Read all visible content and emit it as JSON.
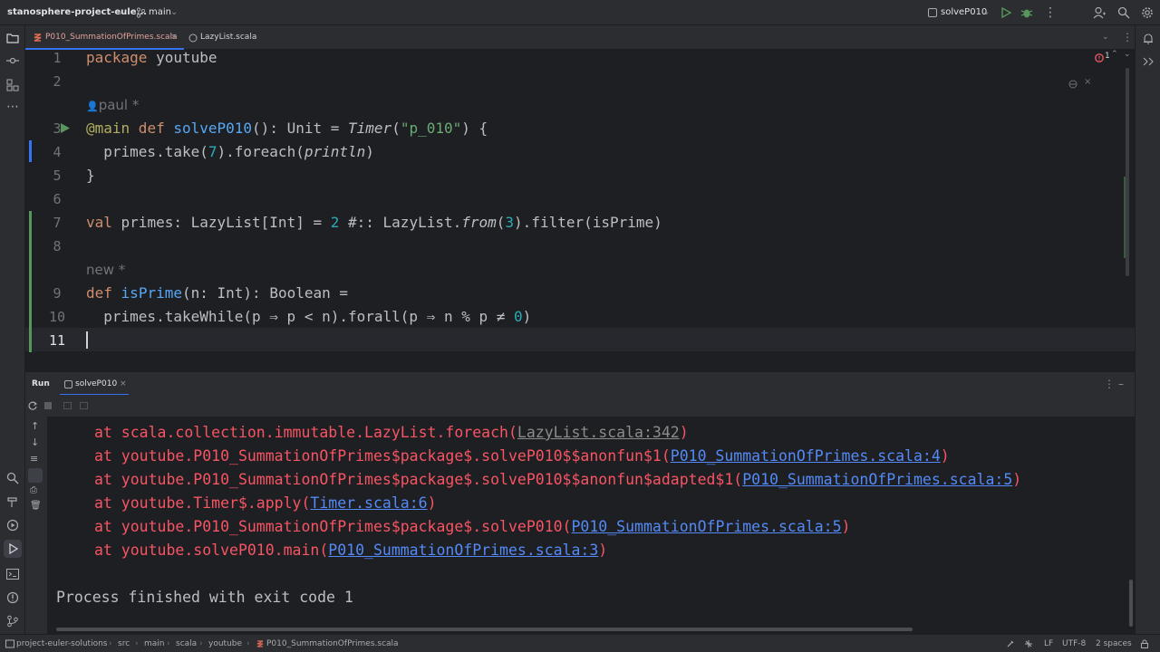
{
  "titlebar": {
    "project": "stanosphere-project-eule...",
    "branch": "main",
    "run_config": "solveP010"
  },
  "tabs": [
    {
      "label": "P010_SummationOfPrimes.scala",
      "active": true
    },
    {
      "label": "LazyList.scala",
      "active": false
    }
  ],
  "editor": {
    "problems_count": "1",
    "line_numbers": [
      "1",
      "2",
      "3",
      "4",
      "5",
      "6",
      "7",
      "8",
      "9",
      "10",
      "11"
    ],
    "author_hint": "paul *",
    "new_hint": "new *",
    "code": {
      "l1_kw": "package",
      "l1_name": " youtube",
      "l3_ann": "@main",
      "l3_def": " def ",
      "l3_fn": "solveP010",
      "l3_rest1": "(): Unit = ",
      "l3_timer": "Timer",
      "l3_paren": "(",
      "l3_str": "\"p_010\"",
      "l3_rest2": ") {",
      "l4_a": "  primes.take(",
      "l4_num": "7",
      "l4_b": ").foreach(",
      "l4_it": "println",
      "l4_c": ")",
      "l5": "}",
      "l7_kw": "val",
      "l7_a": " primes: LazyList[Int] = ",
      "l7_num1": "2",
      "l7_b": " #:: LazyList.",
      "l7_it": "from",
      "l7_c": "(",
      "l7_num2": "3",
      "l7_d": ").filter(isPrime)",
      "l9_kw": "def",
      "l9_sp": " ",
      "l9_fn": "isPrime",
      "l9_rest": "(n: Int): Boolean =",
      "l10_a": "  primes.takeWhile(p ⇒ p < n).forall(p ⇒ n % p ≠ ",
      "l10_num": "0",
      "l10_b": ")"
    }
  },
  "run_panel": {
    "title": "Run",
    "tab": "solveP010"
  },
  "console": {
    "lines": [
      {
        "pre": "at scala.collection.immutable.LazyList.foreach(",
        "link": "LazyList.scala:342",
        "post": ")",
        "gray": true
      },
      {
        "pre": "at youtube.P010_SummationOfPrimes$package$.solveP010$$anonfun$1(",
        "link": "P010_SummationOfPrimes.scala:4",
        "post": ")"
      },
      {
        "pre": "at youtube.P010_SummationOfPrimes$package$.solveP010$$anonfun$adapted$1(",
        "link": "P010_SummationOfPrimes.scala:5",
        "post": ")"
      },
      {
        "pre": "at youtube.Timer$.apply(",
        "link": "Timer.scala:6",
        "post": ")"
      },
      {
        "pre": "at youtube.P010_SummationOfPrimes$package$.solveP010(",
        "link": "P010_SummationOfPrimes.scala:5",
        "post": ")"
      },
      {
        "pre": "at youtube.solveP010.main(",
        "link": "P010_SummationOfPrimes.scala:3",
        "post": ")"
      }
    ],
    "exit": "Process finished with exit code 1"
  },
  "statusbar": {
    "breadcrumbs": [
      "project-euler-solutions",
      "src",
      "main",
      "scala",
      "youtube",
      "P010_SummationOfPrimes.scala"
    ],
    "line_sep": "LF",
    "encoding": "UTF-8",
    "indent": "2 spaces"
  },
  "colors": {
    "keyword": "#cf8e6d",
    "function": "#56a8f5",
    "string": "#6aab73",
    "number": "#2aacb8",
    "error": "#f75464",
    "link": "#548af7"
  }
}
